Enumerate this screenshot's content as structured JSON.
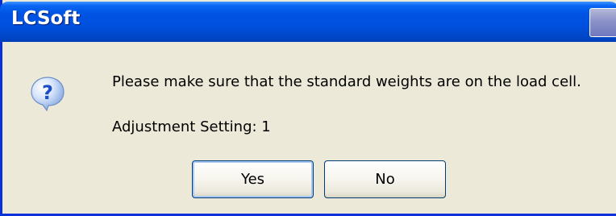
{
  "window": {
    "title": "LCSoft"
  },
  "dialog": {
    "icon": "question-icon",
    "message": "Please make sure that the standard weights are on the load cell.",
    "setting_text": "Adjustment Setting: 1"
  },
  "buttons": {
    "yes_label": "Yes",
    "no_label": "No"
  },
  "colors": {
    "titlebar": "#0054e3",
    "frame": "#0831d9",
    "dialog_background": "#ece9d8",
    "button_border": "#003c74",
    "icon_blue": "#2a5fd0"
  }
}
